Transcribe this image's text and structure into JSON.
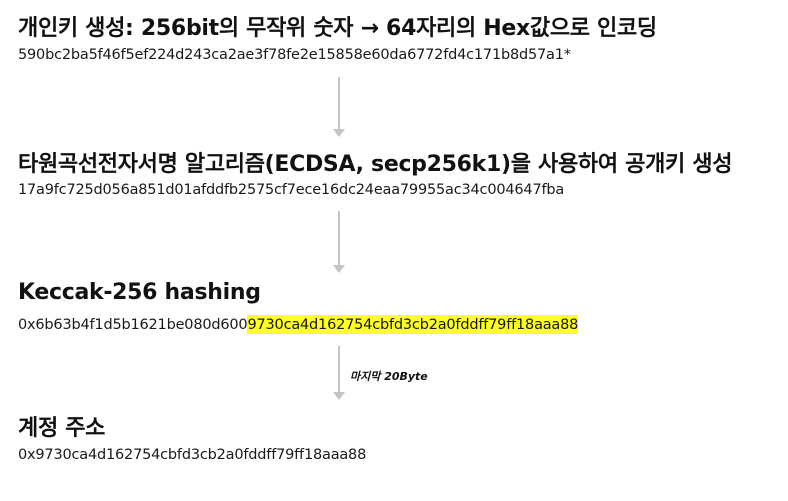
{
  "steps": [
    {
      "title": "개인키 생성: 256bit의 무작위 숫자 → 64자리의 Hex값으로 인코딩",
      "value": "590bc2ba5f46f5ef224d243ca2ae3f78fe2e15858e60da6772fd4c171b8d57a1*"
    },
    {
      "title": "타원곡선전자서명 알고리즘(ECDSA, secp256k1)을 사용하여 공개키 생성",
      "value": "17a9fc725d056a851d01afddfb2575cf7ece16dc24eaa79955ac34c004647fba"
    },
    {
      "title": "Keccak-256 hashing",
      "value_prefix": "0x6b63b4f1d5b1621be080d600",
      "value_highlight": "9730ca4d162754cbfd3cb2a0fddff79ff18aaa88"
    },
    {
      "title": "계정 주소",
      "value": "0x9730ca4d162754cbfd3cb2a0fddff79ff18aaa88"
    }
  ],
  "arrow_label": "마지막 20Byte",
  "colors": {
    "highlight": "#ffff2a",
    "arrow": "#c4c4c4",
    "text": "#111111"
  }
}
